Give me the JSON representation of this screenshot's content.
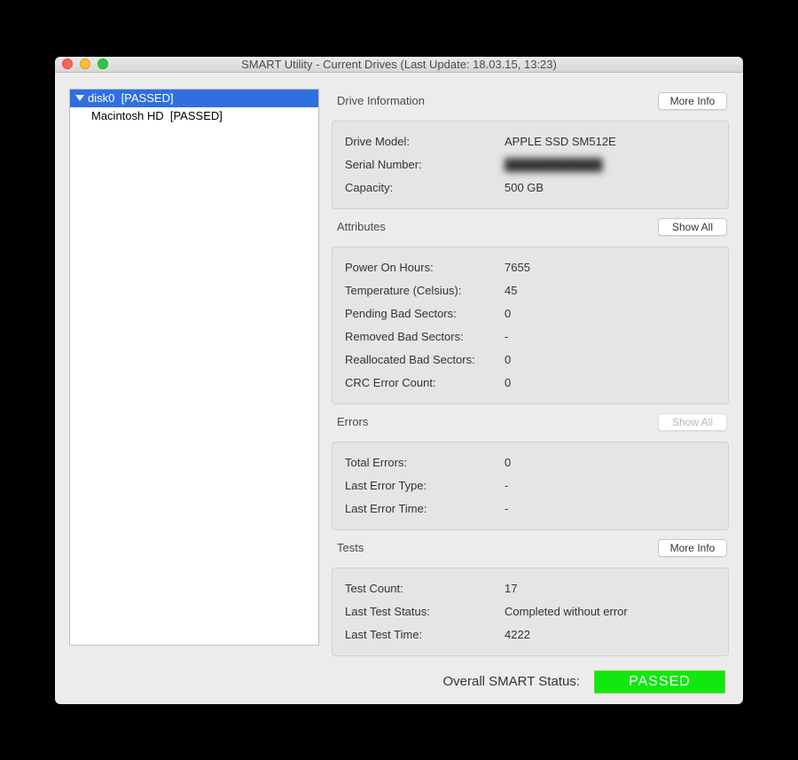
{
  "window": {
    "title": "SMART Utility - Current Drives (Last Update: 18.03.15, 13:23)"
  },
  "sidebar": {
    "items": [
      {
        "label": "disk0  [PASSED]",
        "selected": true,
        "hasChildren": true
      },
      {
        "label": "Macintosh HD  [PASSED]",
        "selected": false,
        "child": true
      }
    ]
  },
  "driveInfo": {
    "header": "Drive Information",
    "button": "More Info",
    "rows": {
      "modelLabel": "Drive Model:",
      "modelValue": "APPLE SSD SM512E",
      "serialLabel": "Serial Number:",
      "serialValue": "████████████",
      "capacityLabel": "Capacity:",
      "capacityValue": "500 GB"
    }
  },
  "attributes": {
    "header": "Attributes",
    "button": "Show All",
    "rows": {
      "powerOnLabel": "Power On Hours:",
      "powerOnValue": "7655",
      "tempLabel": "Temperature (Celsius):",
      "tempValue": "45",
      "pendingLabel": "Pending Bad Sectors:",
      "pendingValue": "0",
      "removedLabel": "Removed Bad Sectors:",
      "removedValue": "-",
      "reallocLabel": "Reallocated Bad Sectors:",
      "reallocValue": "0",
      "crcLabel": "CRC Error Count:",
      "crcValue": "0"
    }
  },
  "errors": {
    "header": "Errors",
    "button": "Show All",
    "rows": {
      "totalLabel": "Total Errors:",
      "totalValue": "0",
      "lastTypeLabel": "Last Error Type:",
      "lastTypeValue": "-",
      "lastTimeLabel": "Last Error Time:",
      "lastTimeValue": "-"
    }
  },
  "tests": {
    "header": "Tests",
    "button": "More Info",
    "rows": {
      "countLabel": "Test Count:",
      "countValue": "17",
      "statusLabel": "Last Test Status:",
      "statusValue": "Completed without error",
      "timeLabel": "Last Test Time:",
      "timeValue": "4222"
    }
  },
  "footer": {
    "label": "Overall SMART Status:",
    "status": "PASSED"
  }
}
